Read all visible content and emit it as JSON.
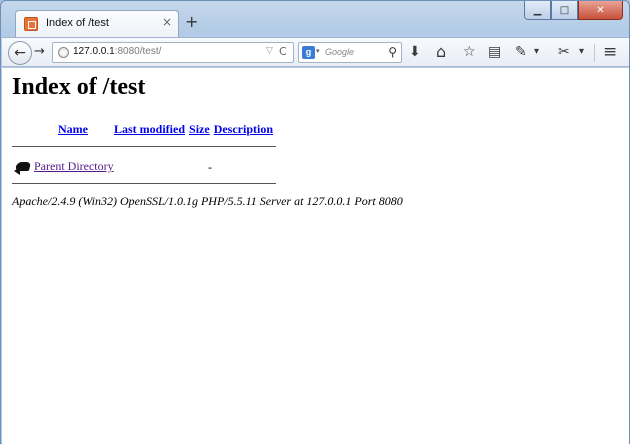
{
  "browser": {
    "tab": {
      "title": "Index of /test",
      "close": "×"
    },
    "new_tab": "+",
    "window_controls": {
      "minimize": "▁",
      "maximize": "□",
      "close": "✕"
    },
    "nav": {
      "back": "←",
      "forward": "→"
    },
    "url": {
      "host": "127.0.0.1",
      "rest": ":8080/test/",
      "dropdown": "▽",
      "reload": "C"
    },
    "search": {
      "engine_letter": "g",
      "dropdown": "▾",
      "placeholder": "Google",
      "button": "⚲"
    },
    "toolbar_icons": {
      "download": "⬇",
      "home": "⌂",
      "bookmark": "☆",
      "reading_list": "▤",
      "dev_tools": "✎",
      "dev_dropdown": "▾",
      "extension": "✂",
      "ext_dropdown": "▾",
      "menu": "≡"
    }
  },
  "page": {
    "title": "Index of /test",
    "columns": [
      "Name",
      "Last modified",
      "Size",
      "Description"
    ],
    "parent": {
      "name": "Parent Directory",
      "size": "-"
    },
    "signature": "Apache/2.4.9 (Win32) OpenSSL/1.0.1g PHP/5.5.11 Server at 127.0.0.1 Port 8080"
  }
}
